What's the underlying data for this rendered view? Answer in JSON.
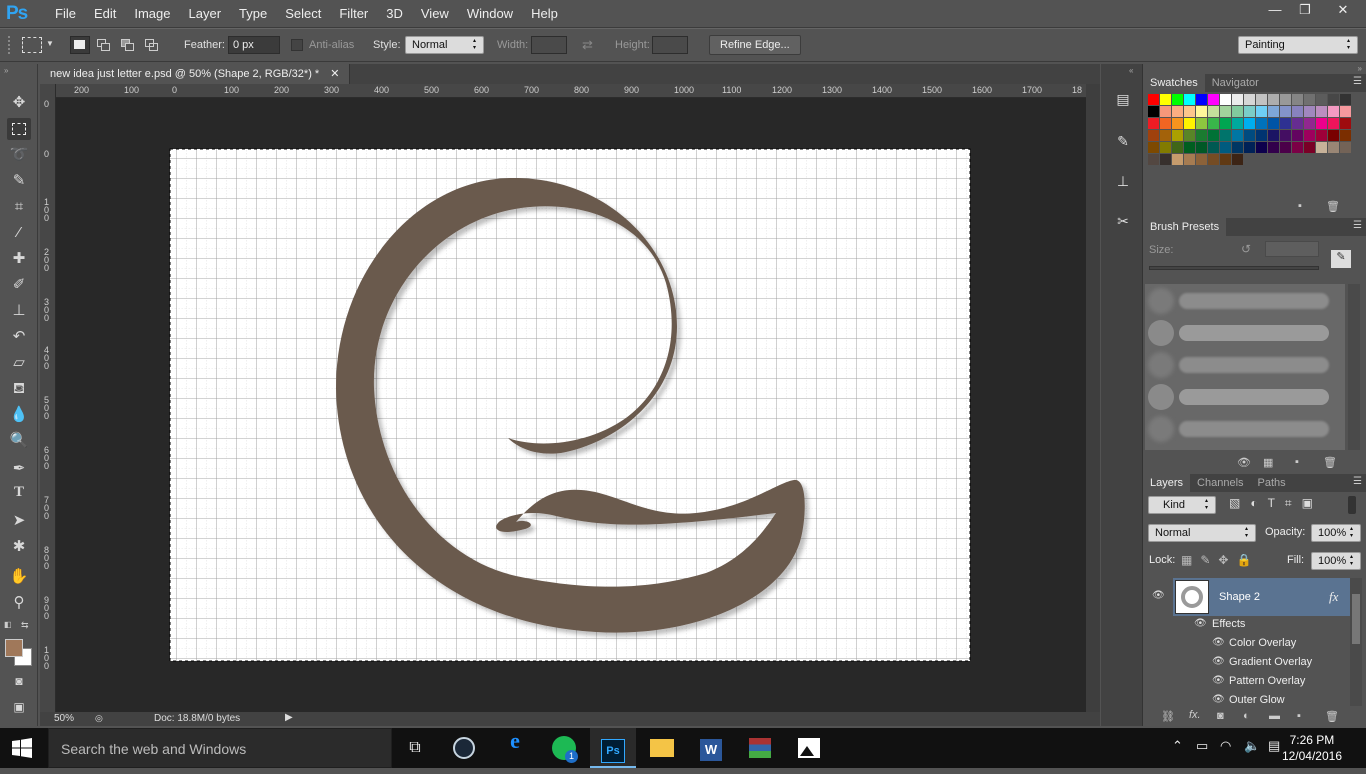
{
  "app": {
    "logo": "Ps",
    "colors": {
      "logo": "#30a4f2",
      "accent": "#5a7391",
      "shape": "#6b5a4e",
      "foreground": "#a0785a"
    }
  },
  "menu": [
    "File",
    "Edit",
    "Image",
    "Layer",
    "Type",
    "Select",
    "Filter",
    "3D",
    "View",
    "Window",
    "Help"
  ],
  "window_controls": {
    "minimize": "—",
    "restore": "❐",
    "close": "✕"
  },
  "options": {
    "feather_label": "Feather:",
    "feather_value": "0 px",
    "antialias_label": "Anti-alias",
    "style_label": "Style:",
    "style_value": "Normal",
    "width_label": "Width:",
    "height_label": "Height:",
    "refine_edge": "Refine Edge...",
    "workspace": "Painting"
  },
  "document": {
    "tab_title": "new idea just letter e.psd @ 50% (Shape 2, RGB/32*) *",
    "close": "✕",
    "zoom": "50%",
    "doc_info": "Doc: 18.8M/0 bytes"
  },
  "ruler_h": [
    "200",
    "100",
    "0",
    "100",
    "200",
    "300",
    "400",
    "500",
    "600",
    "700",
    "800",
    "900",
    "1000",
    "1100",
    "1200",
    "1300",
    "1400",
    "1500",
    "1600",
    "1700",
    "18"
  ],
  "ruler_v": [
    "0",
    "0",
    "1 0 0",
    "2 0 0",
    "3 0 0",
    "4 0 0",
    "5 0 0",
    "6 0 0",
    "7 0 0",
    "8 0 0",
    "9 0 0",
    "1 0 0"
  ],
  "swatches_panel": {
    "tabs": [
      "Swatches",
      "Navigator"
    ]
  },
  "swatch_colors": [
    "#ff0000",
    "#ffff00",
    "#00ff00",
    "#00ffff",
    "#0000ff",
    "#ff00ff",
    "#ffffff",
    "#ebebeb",
    "#d6d6d6",
    "#c2c2c2",
    "#adadad",
    "#999999",
    "#858585",
    "#707070",
    "#5c5c5c",
    "#474747",
    "#333333",
    "#000000",
    "#f7977a",
    "#fbad82",
    "#fdc68c",
    "#fff79a",
    "#c4df9b",
    "#a2d39c",
    "#82ca9d",
    "#7bcdc8",
    "#6ecff6",
    "#7ea7d8",
    "#8493ca",
    "#8882be",
    "#a187be",
    "#bc8dbf",
    "#f49ac2",
    "#f6989d",
    "#ed1c24",
    "#f26522",
    "#f7941d",
    "#fff200",
    "#8dc63f",
    "#39b54a",
    "#00a651",
    "#00a99d",
    "#00aeef",
    "#0072bc",
    "#0054a6",
    "#2e3192",
    "#662d91",
    "#92278f",
    "#ec008c",
    "#ed145b",
    "#9e0b0f",
    "#a0410d",
    "#a3620a",
    "#aba000",
    "#598527",
    "#1a7b30",
    "#007236",
    "#00746b",
    "#0076a3",
    "#004b80",
    "#003471",
    "#1b1464",
    "#440e62",
    "#630460",
    "#9e005d",
    "#9e0039",
    "#790000",
    "#7b2e00",
    "#7d4900",
    "#827b00",
    "#406618",
    "#005e20",
    "#005826",
    "#005952",
    "#005b7f",
    "#003663",
    "#002157",
    "#0d004c",
    "#32004b",
    "#4b0049",
    "#7b0046",
    "#7a0026",
    "#c7b299",
    "#998675",
    "#736357",
    "#534741",
    "#37302d",
    "#c69c6d",
    "#a67c52",
    "#8c6239",
    "#754c24",
    "#603913",
    "#3c2415"
  ],
  "brush_panel": {
    "title": "Brush Presets",
    "size_label": "Size:"
  },
  "layers_panel": {
    "tabs": [
      "Layers",
      "Channels",
      "Paths"
    ],
    "kind": "Kind",
    "blend_mode": "Normal",
    "opacity_label": "Opacity:",
    "opacity_value": "100%",
    "lock_label": "Lock:",
    "fill_label": "Fill:",
    "fill_value": "100%",
    "layer_name": "Shape 2",
    "fx": "fx",
    "effects_label": "Effects",
    "effects": [
      "Color Overlay",
      "Gradient Overlay",
      "Pattern Overlay",
      "Outer Glow"
    ]
  },
  "taskbar": {
    "search_placeholder": "Search the web and Windows",
    "time": "7:26 PM",
    "date": "12/04/2016",
    "spotify_badge": "1"
  }
}
